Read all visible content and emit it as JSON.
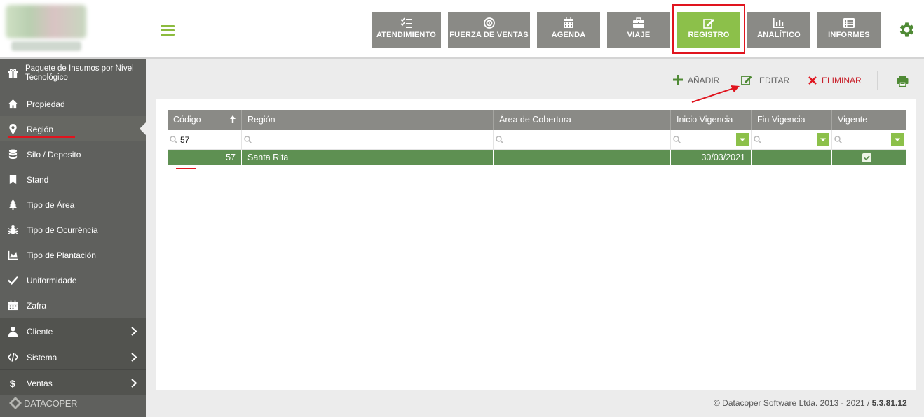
{
  "header": {
    "modules": [
      {
        "label": "ATENDIMIENTO",
        "icon": "checklist-icon"
      },
      {
        "label": "FUERZA DE VENTAS",
        "icon": "target-icon"
      },
      {
        "label": "AGENDA",
        "icon": "calendar-icon"
      },
      {
        "label": "VIAJE",
        "icon": "briefcase-icon"
      },
      {
        "label": "REGISTRO",
        "icon": "edit-icon",
        "active": true
      },
      {
        "label": "ANALÍTICO",
        "icon": "bar-chart-icon"
      },
      {
        "label": "INFORMES",
        "icon": "list-icon"
      }
    ]
  },
  "sidebar": {
    "items": [
      {
        "label": "Paquete de Insumos por Nível Tecnológico",
        "icon": "gift-icon"
      },
      {
        "label": "Propiedad",
        "icon": "home-icon"
      },
      {
        "label": "Región",
        "icon": "map-marker-icon",
        "active": true
      },
      {
        "label": "Silo / Deposito",
        "icon": "database-icon"
      },
      {
        "label": "Stand",
        "icon": "bookmark-icon"
      },
      {
        "label": "Tipo de Área",
        "icon": "tree-icon"
      },
      {
        "label": "Tipo de Ocurrência",
        "icon": "bug-icon"
      },
      {
        "label": "Tipo de Plantación",
        "icon": "area-chart-icon"
      },
      {
        "label": "Uniformidade",
        "icon": "check-icon"
      },
      {
        "label": "Zafra",
        "icon": "calendar-icon"
      }
    ],
    "groups": [
      {
        "label": "Cliente",
        "icon": "user-icon"
      },
      {
        "label": "Sistema",
        "icon": "code-icon"
      },
      {
        "label": "Ventas",
        "icon": "dollar-icon"
      }
    ],
    "brand": "DATACOPER"
  },
  "toolbar": {
    "add_label": "AÑADIR",
    "edit_label": "EDITAR",
    "delete_label": "ELIMINAR"
  },
  "grid": {
    "columns": [
      "Código",
      "Región",
      "Área de Cobertura",
      "Inicio Vigencia",
      "Fin Vigencia",
      "Vigente"
    ],
    "filters": {
      "codigo": "57"
    },
    "rows": [
      {
        "codigo": "57",
        "region": "Santa Rita",
        "area": "",
        "inicio": "30/03/2021",
        "fin": "",
        "vigente": true
      }
    ]
  },
  "footer": {
    "text": "© Datacoper Software Ltda. 2013 - 2021 / ",
    "version": "5.3.81.12"
  },
  "colors": {
    "accent": "#8cc04a",
    "module_bg": "#8a8a86",
    "sidebar_bg": "#5f605d",
    "row_selected": "#5e9052",
    "delete": "#e0141e",
    "annotation": "#e0141e"
  }
}
